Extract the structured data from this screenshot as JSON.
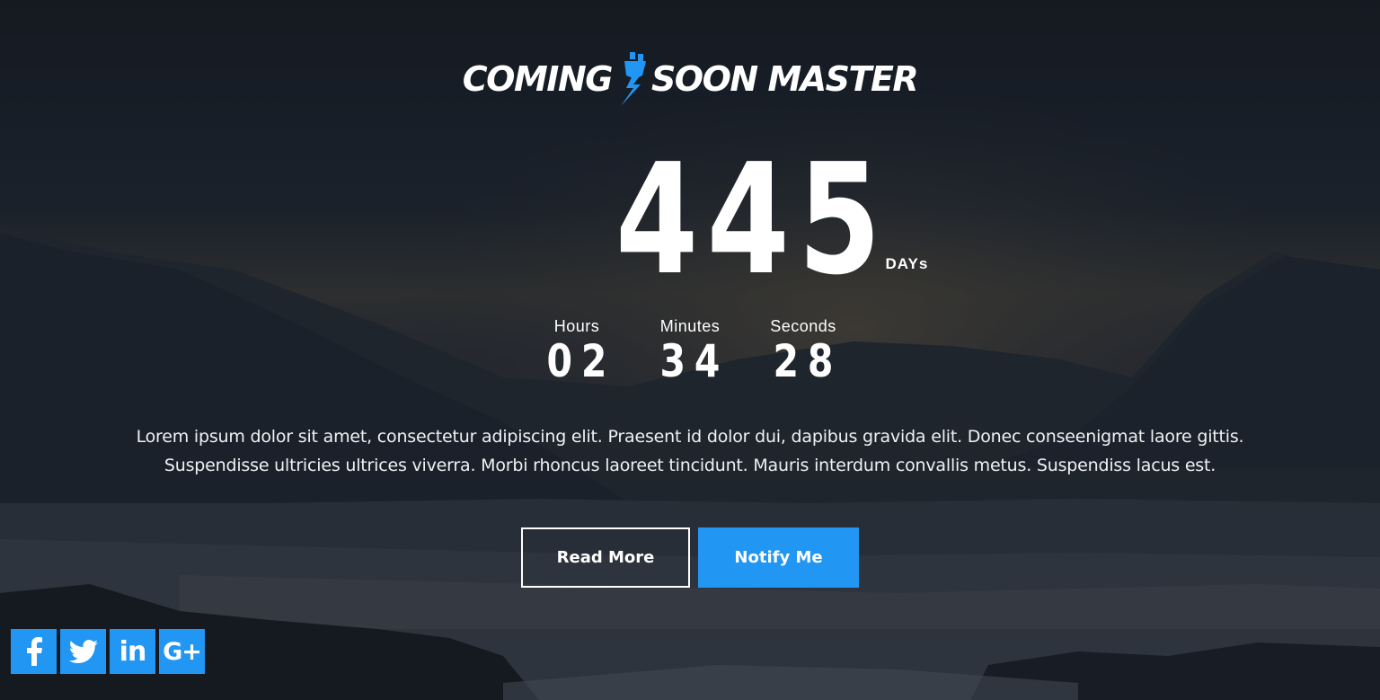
{
  "logo": {
    "left_text": "COMING",
    "right_text": "SOON MASTER",
    "icon": "plug-lightning-icon"
  },
  "countdown": {
    "days": "445",
    "days_label": "DAYs",
    "hours_label": "Hours",
    "hours": "02",
    "minutes_label": "Minutes",
    "minutes": "34",
    "seconds_label": "Seconds",
    "seconds": "28"
  },
  "description": "Lorem ipsum dolor sit amet, consectetur adipiscing elit. Praesent id dolor dui, dapibus gravida elit. Donec conseenigmat laore gittis. Suspendisse ultricies ultrices viverra. Morbi rhoncus laoreet tincidunt. Mauris interdum convallis metus. Suspendiss lacus est.",
  "buttons": {
    "read_more": "Read More",
    "notify_me": "Notify Me"
  },
  "social": [
    {
      "name": "facebook-icon",
      "glyph": "f"
    },
    {
      "name": "twitter-icon",
      "glyph": ""
    },
    {
      "name": "linkedin-icon",
      "glyph": "in"
    },
    {
      "name": "google-plus-icon",
      "glyph": "G+"
    }
  ],
  "colors": {
    "accent": "#2196f3",
    "background": "#1d232c",
    "text": "#ffffff"
  }
}
